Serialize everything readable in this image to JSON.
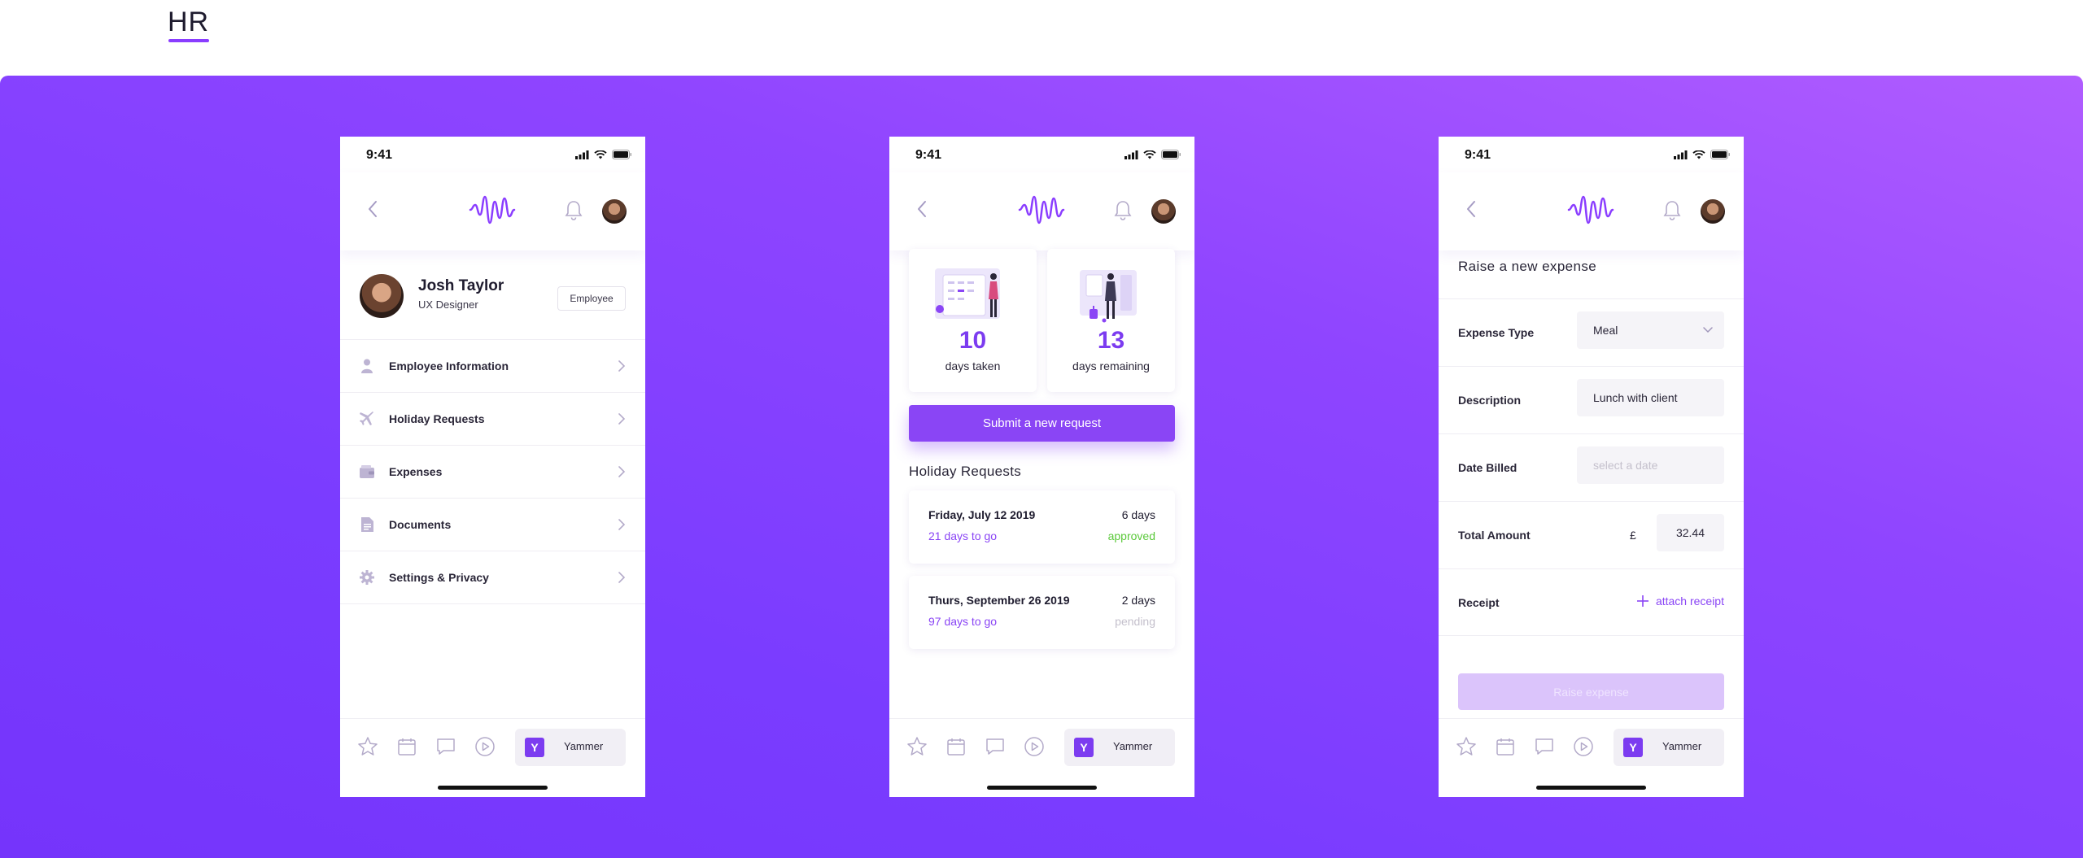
{
  "page": {
    "title": "HR"
  },
  "colors": {
    "accent": "#8a45f5",
    "approved": "#5cc93c",
    "pending": "#c4c0cc"
  },
  "status_bar": {
    "time": "9:41"
  },
  "profile_screen": {
    "name": "Josh Taylor",
    "role": "UX Designer",
    "badge": "Employee",
    "menu": [
      {
        "label": "Employee Information",
        "icon": "person-icon"
      },
      {
        "label": "Holiday Requests",
        "icon": "plane-icon"
      },
      {
        "label": "Expenses",
        "icon": "wallet-icon"
      },
      {
        "label": "Documents",
        "icon": "document-icon"
      },
      {
        "label": "Settings & Privacy",
        "icon": "gear-icon"
      }
    ]
  },
  "holiday_screen": {
    "stats": [
      {
        "number": "10",
        "caption": "days taken"
      },
      {
        "number": "13",
        "caption": "days remaining"
      }
    ],
    "submit_label": "Submit a new request",
    "section_title": "Holiday Requests",
    "requests": [
      {
        "date": "Friday, July 12 2019",
        "days": "6 days",
        "to_go": "21 days to go",
        "status": "approved"
      },
      {
        "date": "Thurs, September 26 2019",
        "days": "2 days",
        "to_go": "97 days to go",
        "status": "pending"
      }
    ]
  },
  "expense_screen": {
    "title": "Raise a new expense",
    "fields": {
      "expense_type": {
        "label": "Expense Type",
        "value": "Meal"
      },
      "description": {
        "label": "Description",
        "value": "Lunch with client"
      },
      "date_billed": {
        "label": "Date Billed",
        "placeholder": "select a date"
      },
      "total_amount": {
        "label": "Total Amount",
        "currency": "£",
        "value": "32.44"
      },
      "receipt": {
        "label": "Receipt",
        "action": "attach receipt"
      }
    },
    "submit_label": "Raise expense"
  },
  "tab_bar": {
    "yammer_label": "Yammer",
    "yammer_letter": "Y"
  }
}
